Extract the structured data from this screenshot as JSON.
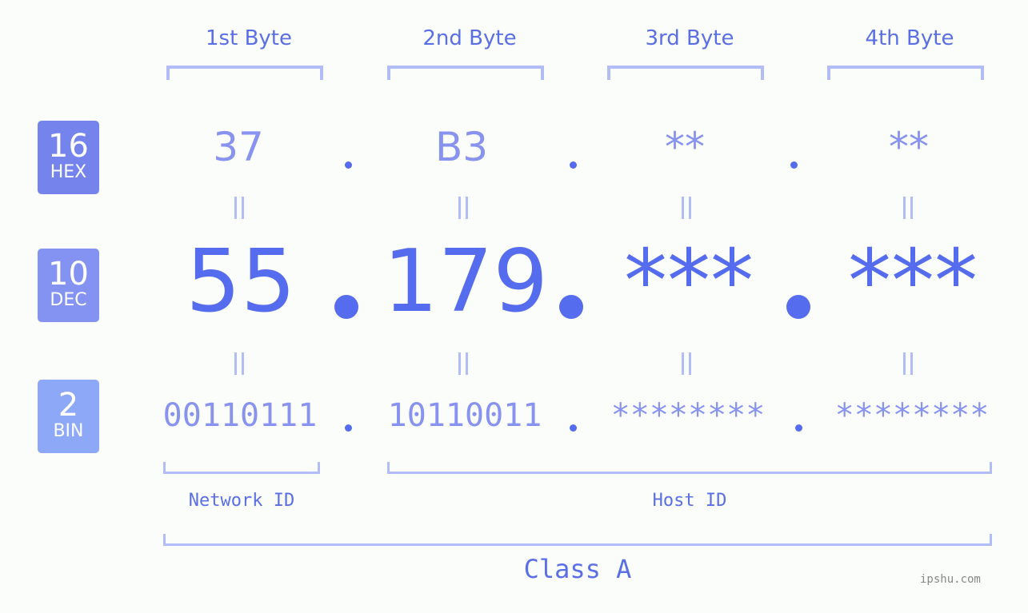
{
  "bytes": [
    {
      "label": "1st Byte",
      "hex": "37",
      "dec": "55",
      "bin": "00110111"
    },
    {
      "label": "2nd Byte",
      "hex": "B3",
      "dec": "179",
      "bin": "10110011"
    },
    {
      "label": "3rd Byte",
      "hex": "**",
      "dec": "***",
      "bin": "********"
    },
    {
      "label": "4th Byte",
      "hex": "**",
      "dec": "***",
      "bin": "********"
    }
  ],
  "bases": [
    {
      "num": "16",
      "name": "HEX",
      "color": "#7584ec"
    },
    {
      "num": "10",
      "name": "DEC",
      "color": "#8493f1"
    },
    {
      "num": "2",
      "name": "BIN",
      "color": "#8ea8f8"
    }
  ],
  "segments": {
    "network": "Network ID",
    "host": "Host ID",
    "class": "Class A"
  },
  "watermark": "ipshu.com",
  "colors": {
    "accent": "#566cef",
    "light_accent": "#8793ef",
    "bracket": "#b2bcf6",
    "background": "#fbfdfb"
  }
}
